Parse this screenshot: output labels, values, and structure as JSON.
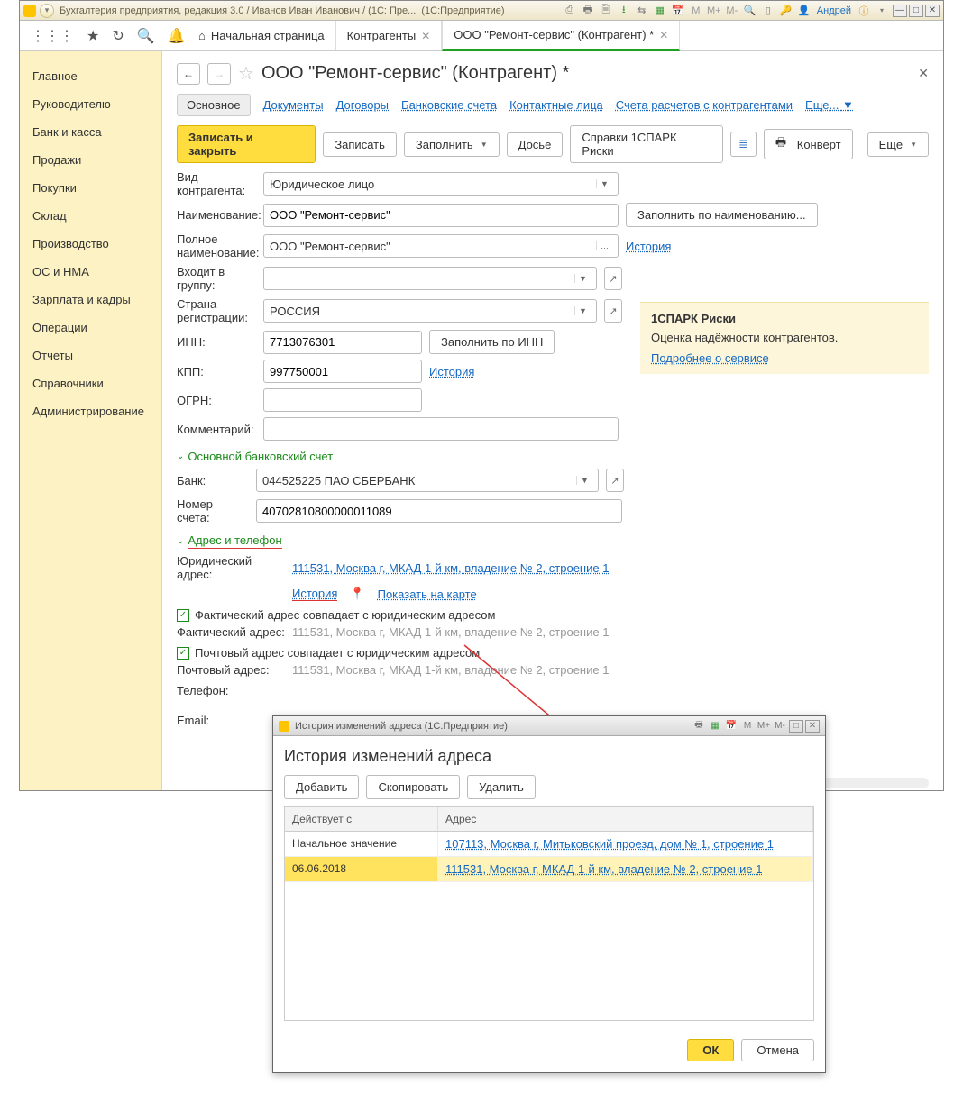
{
  "titlebar": {
    "text_a": "Бухгалтерия предприятия, редакция 3.0 / Иванов Иван Иванович / (1С: Пре...",
    "text_b": "(1С:Предприятие)",
    "m": "M",
    "mplus": "M+",
    "mminus": "M-",
    "user": "Андрей"
  },
  "tabs": {
    "home": "Начальная страница",
    "t1": "Контрагенты",
    "t2": "ООО \"Ремонт-сервис\" (Контрагент) *"
  },
  "sidebar": {
    "items": [
      "Главное",
      "Руководителю",
      "Банк и касса",
      "Продажи",
      "Покупки",
      "Склад",
      "Производство",
      "ОС и НМА",
      "Зарплата и кадры",
      "Операции",
      "Отчеты",
      "Справочники",
      "Администрирование"
    ]
  },
  "header": {
    "title": "ООО \"Ремонт-сервис\" (Контрагент) *"
  },
  "subtabs": {
    "main": "Основное",
    "docs": "Документы",
    "contracts": "Договоры",
    "bank": "Банковские счета",
    "contacts": "Контактные лица",
    "accounts": "Счета расчетов с контрагентами",
    "more": "Еще..."
  },
  "toolbar": {
    "save_close": "Записать и закрыть",
    "save": "Записать",
    "fill": "Заполнить",
    "dossier": "Досье",
    "spark": "Справки 1СПАРК Риски",
    "envelope": "Конверт",
    "more": "Еще"
  },
  "form": {
    "type_label": "Вид контрагента:",
    "type_value": "Юридическое лицо",
    "name_label": "Наименование:",
    "name_value": "ООО \"Ремонт-сервис\"",
    "fill_by_name_btn": "Заполнить по наименованию...",
    "fullname_label": "Полное наименование:",
    "fullname_value": "ООО \"Ремонт-сервис\"",
    "history_link": "История",
    "group_label": "Входит в группу:",
    "country_label": "Страна регистрации:",
    "country_value": "РОССИЯ",
    "inn_label": "ИНН:",
    "inn_value": "7713076301",
    "fill_inn_btn": "Заполнить по ИНН",
    "kpp_label": "КПП:",
    "kpp_value": "997750001",
    "ogrn_label": "ОГРН:",
    "comment_label": "Комментарий:"
  },
  "info": {
    "title": "1СПАРК Риски",
    "subtitle": "Оценка надёжности контрагентов.",
    "link": "Подробнее о сервисе"
  },
  "bank": {
    "section": "Основной банковский счет",
    "bank_label": "Банк:",
    "bank_value": "044525225 ПАО СБЕРБАНК",
    "acc_label": "Номер счета:",
    "acc_value": "40702810800000011089"
  },
  "addr": {
    "section": "Адрес и телефон",
    "legal_label": "Юридический адрес:",
    "legal_value": "111531, Москва г, МКАД 1-й км, владение № 2, строение 1",
    "history": "История",
    "showmap": "Показать на карте",
    "fact_chk": "Фактический адрес совпадает с юридическим адресом",
    "fact_label": "Фактический адрес:",
    "fact_value": "111531, Москва г, МКАД 1-й км, владение № 2, строение 1",
    "post_chk": "Почтовый адрес совпадает с юридическим адресом",
    "post_label": "Почтовый адрес:",
    "post_value": "111531, Москва г, МКАД 1-й км, владение № 2, строение 1",
    "phone_label": "Телефон:",
    "email_label": "Email:"
  },
  "dialog": {
    "wintitle": "История изменений адреса  (1С:Предприятие)",
    "m": "M",
    "mplus": "M+",
    "mminus": "M-",
    "title": "История изменений адреса",
    "add": "Добавить",
    "copy": "Скопировать",
    "del": "Удалить",
    "col1": "Действует с",
    "col2": "Адрес",
    "row1_c1": "Начальное значение",
    "row1_c2": "107113, Москва г, Митьковский проезд, дом № 1, строение 1",
    "row2_c1": "06.06.2018",
    "row2_c2": "111531, Москва г, МКАД 1-й км, владение № 2, строение 1",
    "ok": "ОК",
    "cancel": "Отмена"
  }
}
